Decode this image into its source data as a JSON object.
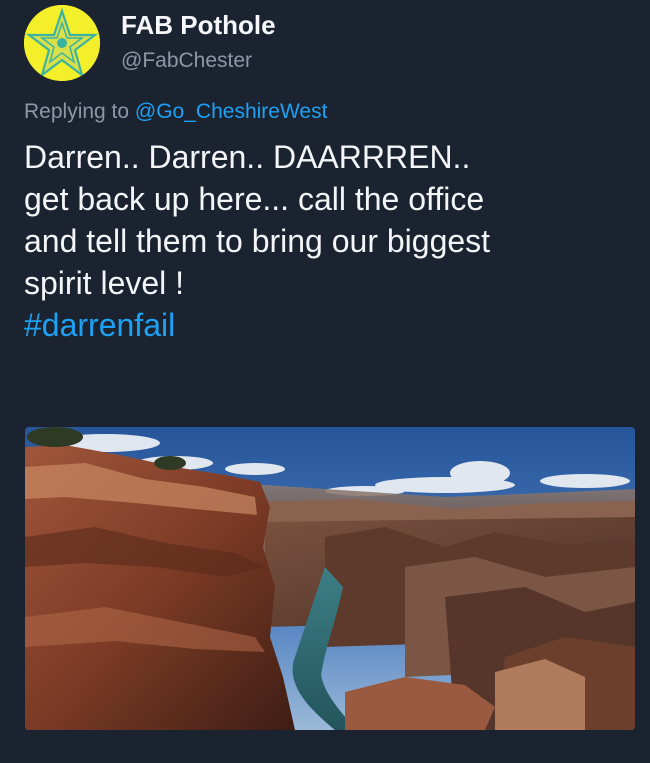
{
  "author": {
    "display_name": "FAB Pothole",
    "handle": "@FabChester",
    "avatar_icon": "yellow-star-avatar"
  },
  "reply": {
    "prefix": "Replying to",
    "mention": "@Go_CheshireWest"
  },
  "tweet": {
    "lines": [
      "Darren.. Darren.. DAARRREN..",
      "get back up here... call the office",
      "and tell them to bring our biggest",
      "spirit level !"
    ],
    "hashtag": "#darrenfail"
  },
  "media": {
    "subject": "canyon-landscape-photo"
  },
  "colors": {
    "background": "#1b2331",
    "link": "#1da1f2",
    "secondary_text": "#8b98a6",
    "primary_text": "#f3f5f7",
    "avatar": "#f3ef2a"
  }
}
